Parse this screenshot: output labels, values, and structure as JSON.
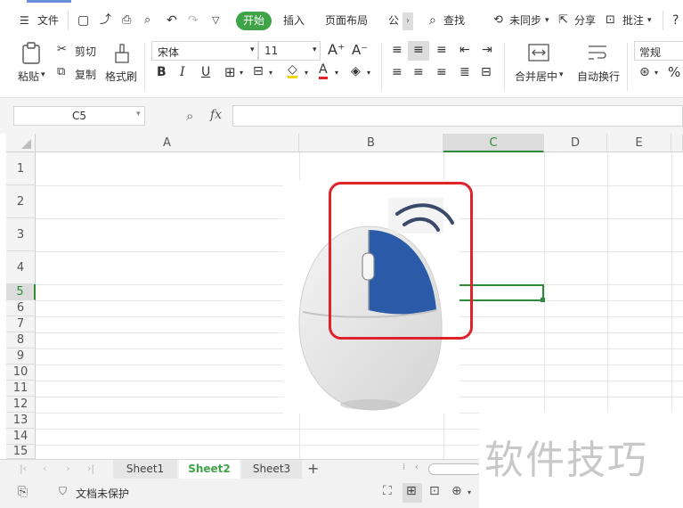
{
  "menubar": {
    "menu_label": "文件",
    "tabs": [
      "开始",
      "插入",
      "页面布局",
      "公"
    ],
    "search_label": "查找",
    "sync_label": "未同步",
    "share_label": "分享",
    "comment_label": "批注"
  },
  "ribbon": {
    "paste_label": "粘贴",
    "cut_label": "剪切",
    "copy_label": "复制",
    "format_painter_label": "格式刷",
    "font_name": "宋体",
    "font_size": "11",
    "bold_label": "B",
    "italic_label": "I",
    "underline_label": "U",
    "font_color_label": "A",
    "merge_label": "合并居中",
    "wrap_label": "自动换行",
    "number_format": "常规",
    "percent_label": "%"
  },
  "formula_bar": {
    "name_box": "C5",
    "fx_label": "fx"
  },
  "grid": {
    "columns": [
      "A",
      "B",
      "C",
      "D",
      "E"
    ],
    "rows": [
      "1",
      "2",
      "3",
      "4",
      "5",
      "6",
      "7",
      "8",
      "9",
      "10",
      "11",
      "12",
      "13",
      "14",
      "15"
    ],
    "selected_cell": "C5",
    "selection_color": "#2e8b3e"
  },
  "sheets": {
    "tabs": [
      "Sheet1",
      "Sheet2",
      "Sheet3"
    ],
    "active": "Sheet2",
    "add_label": "+"
  },
  "status": {
    "protect_label": "文档未保护"
  },
  "image": {
    "mouse_color": "#e8e8e8",
    "highlight_color": "#2a5aa8",
    "box_color": "#e0232a"
  },
  "watermark": {
    "text": "软件技巧"
  },
  "colors": {
    "accent_green": "#3fa348",
    "header_bg": "#f4f4f4"
  }
}
